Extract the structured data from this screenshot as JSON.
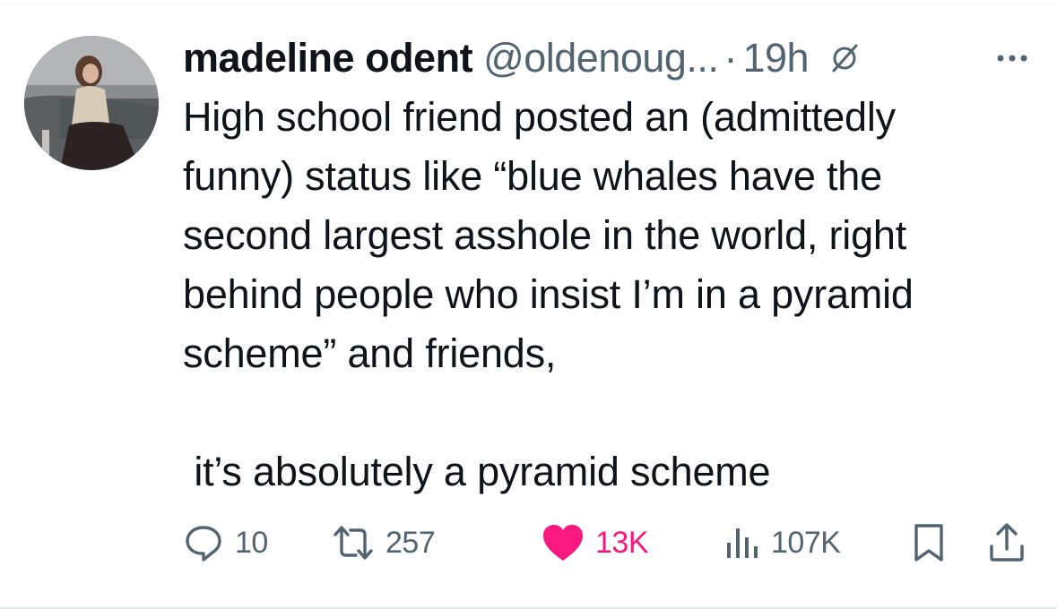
{
  "author": {
    "display_name": "madeline odent",
    "handle": "@oldenoug...",
    "separator": "·",
    "time": "19h",
    "avatar_icon": "profile-photo"
  },
  "tweet": {
    "text": "High school friend posted an (admittedly\nfunny) status like “blue whales have the\nsecond largest asshole in the world, right\nbehind people who insist I’m in a pyramid\nscheme” and friends,\n\n it’s absolutely a pyramid scheme"
  },
  "actions": {
    "replies": "10",
    "reposts": "257",
    "likes": "13K",
    "views": "107K"
  },
  "colors": {
    "text": "#0f1419",
    "secondary": "#536471",
    "like": "#f91880"
  },
  "icons": [
    "grok-icon",
    "more-icon",
    "reply-icon",
    "repost-icon",
    "like-heart-icon",
    "views-icon",
    "bookmark-icon",
    "share-icon"
  ]
}
